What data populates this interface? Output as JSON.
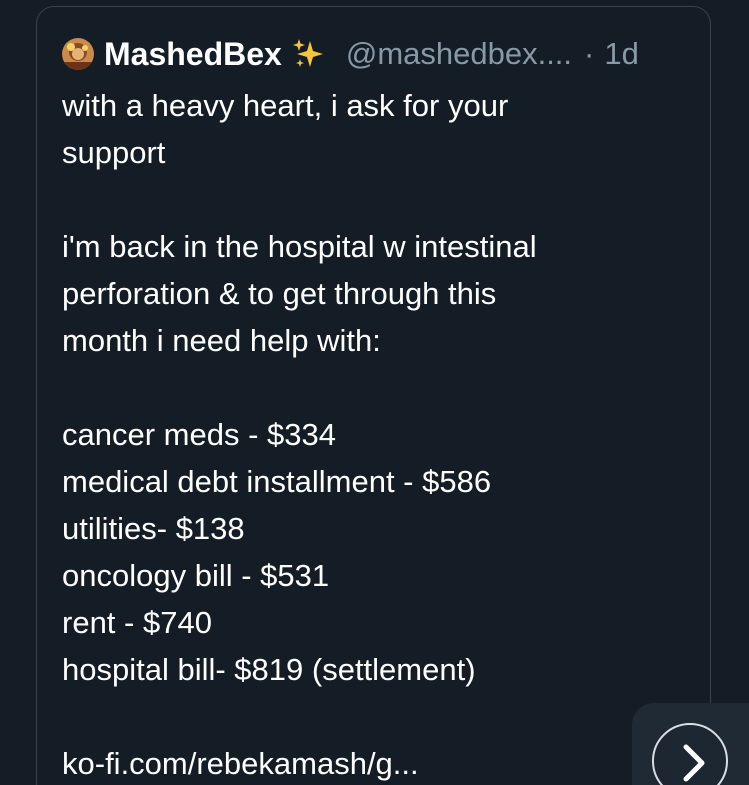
{
  "tweet": {
    "display_name": "MashedBex",
    "emoji_icon": "sparkles-icon",
    "handle": "@mashedbex....",
    "separator": "·",
    "timestamp": "1d",
    "lines": [
      "with a heavy heart, i ask for your",
      "support",
      "",
      "i'm back in the hospital w intestinal",
      "perforation & to get through this",
      "month i need help with:",
      "",
      "cancer meds - $334",
      "medical debt installment - $586",
      "utilities- $138",
      "oncology bill - $531",
      "rent - $740",
      "hospital bill- $819 (settlement)",
      "",
      "ko-fi.com/rebekamash/g..."
    ]
  },
  "controls": {
    "next_icon": "chevron-right-icon"
  },
  "colors": {
    "background": "#141d26",
    "text": "#ffffff",
    "muted": "#8899a6",
    "border": "#38444d"
  }
}
